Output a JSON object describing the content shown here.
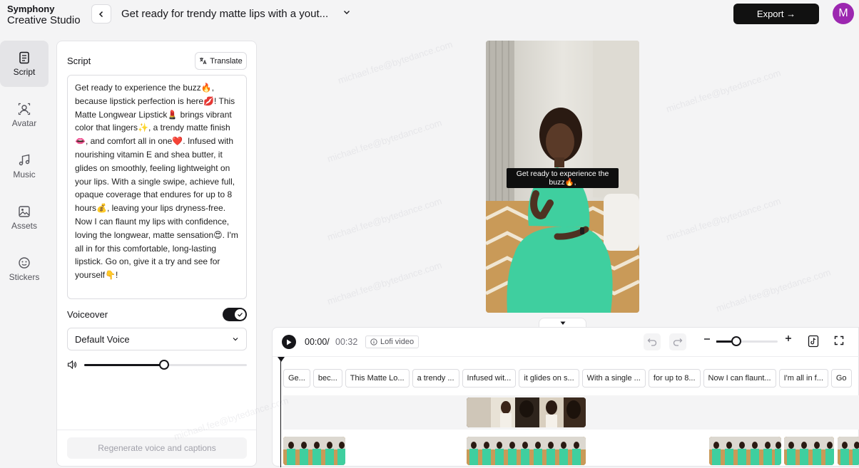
{
  "header": {
    "brand_line1": "Symphony",
    "brand_line2": "Creative Studio",
    "title": "Get ready for trendy matte lips with a yout...",
    "export_label": "Export →",
    "user_initial": "M"
  },
  "rail": [
    {
      "label": "Script",
      "icon": "script-icon",
      "active": true
    },
    {
      "label": "Avatar",
      "icon": "avatar-icon",
      "active": false
    },
    {
      "label": "Music",
      "icon": "music-icon",
      "active": false
    },
    {
      "label": "Assets",
      "icon": "assets-icon",
      "active": false
    },
    {
      "label": "Stickers",
      "icon": "stickers-icon",
      "active": false
    }
  ],
  "script_panel": {
    "label": "Script",
    "translate_label": "Translate",
    "script_text": " Get ready to experience the buzz🔥, because lipstick perfection is here💋! This Matte Longwear Lipstick💄 brings vibrant color that lingers✨, a trendy matte finish👄, and comfort all in one❤️. Infused with nourishing vitamin E and shea butter, it glides on smoothly, feeling lightweight on your lips. With a single swipe, achieve full, opaque coverage that endures for up to 8 hours💰, leaving your lips dryness-free. Now I can flaunt my lips with confidence, loving the longwear, matte sensation😍. I'm all in for this comfortable, long-lasting lipstick. Go on, give it a try and see for yourself👇!",
    "voiceover_label": "Voiceover",
    "voiceover_on": true,
    "voice_selected": "Default Voice",
    "volume": 0.49,
    "regenerate_label": "Regenerate voice and captions"
  },
  "preview": {
    "caption": "Get ready to experience the buzz🔥,"
  },
  "timeline": {
    "current_time": "00:00",
    "separator": "/",
    "total_time": "00:32",
    "music_badge": "Lofi video",
    "zoom": 0.33,
    "captions": [
      "Ge...",
      "bec...",
      "This Matte Lo...",
      "a trendy ...",
      "Infused wit...",
      "it glides on s...",
      "With a single ...",
      "for up to 8...",
      "Now I can flaunt...",
      "I'm all in f...",
      "Go"
    ]
  },
  "colors": {
    "accent": "#16161a",
    "avatar_bg": "#9c27b0",
    "dress": "#3fcf9f"
  }
}
